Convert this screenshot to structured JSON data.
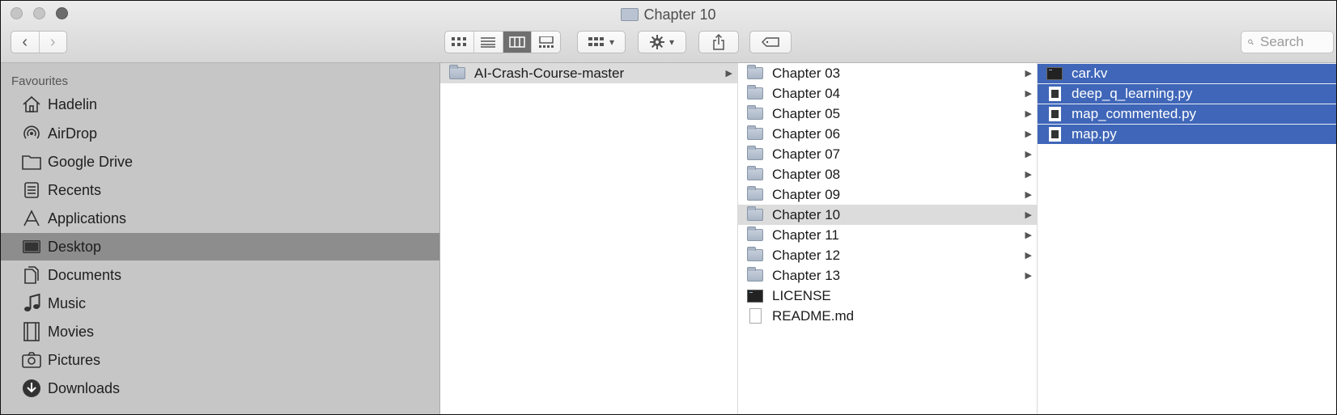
{
  "window": {
    "title": "Chapter 10"
  },
  "toolbar": {
    "back_label": "‹",
    "forward_label": "›",
    "arrange_glyph": "▾",
    "action_glyph": "▾",
    "search_placeholder": "Search"
  },
  "sidebar": {
    "section_title": "Favourites",
    "items": [
      {
        "label": "Hadelin",
        "icon": "home-icon"
      },
      {
        "label": "AirDrop",
        "icon": "airdrop-icon"
      },
      {
        "label": "Google Drive",
        "icon": "folder-icon"
      },
      {
        "label": "Recents",
        "icon": "recents-icon"
      },
      {
        "label": "Applications",
        "icon": "applications-icon"
      },
      {
        "label": "Desktop",
        "icon": "desktop-icon",
        "selected": true
      },
      {
        "label": "Documents",
        "icon": "documents-icon"
      },
      {
        "label": "Music",
        "icon": "music-icon"
      },
      {
        "label": "Movies",
        "icon": "movies-icon"
      },
      {
        "label": "Pictures",
        "icon": "pictures-icon"
      },
      {
        "label": "Downloads",
        "icon": "downloads-icon"
      }
    ]
  },
  "columns": {
    "col1": [
      {
        "label": "AI-Crash-Course-master",
        "kind": "folder",
        "highlighted": true
      }
    ],
    "col2": [
      {
        "label": "Chapter 03",
        "kind": "folder"
      },
      {
        "label": "Chapter 04",
        "kind": "folder"
      },
      {
        "label": "Chapter 05",
        "kind": "folder"
      },
      {
        "label": "Chapter 06",
        "kind": "folder"
      },
      {
        "label": "Chapter 07",
        "kind": "folder"
      },
      {
        "label": "Chapter 08",
        "kind": "folder"
      },
      {
        "label": "Chapter 09",
        "kind": "folder"
      },
      {
        "label": "Chapter 10",
        "kind": "folder",
        "highlighted": true
      },
      {
        "label": "Chapter 11",
        "kind": "folder"
      },
      {
        "label": "Chapter 12",
        "kind": "folder"
      },
      {
        "label": "Chapter 13",
        "kind": "folder"
      },
      {
        "label": "LICENSE",
        "kind": "terminal"
      },
      {
        "label": "README.md",
        "kind": "document"
      }
    ],
    "col3": [
      {
        "label": "car.kv",
        "kind": "terminal",
        "selected": true
      },
      {
        "label": "deep_q_learning.py",
        "kind": "python",
        "selected": true
      },
      {
        "label": "map_commented.py",
        "kind": "python",
        "selected": true
      },
      {
        "label": "map.py",
        "kind": "python",
        "selected": true
      }
    ]
  },
  "colors": {
    "selection": "#3f66b8",
    "sidebar": "#c6c6c6",
    "sidebar_selected": "#8d8d8d"
  }
}
